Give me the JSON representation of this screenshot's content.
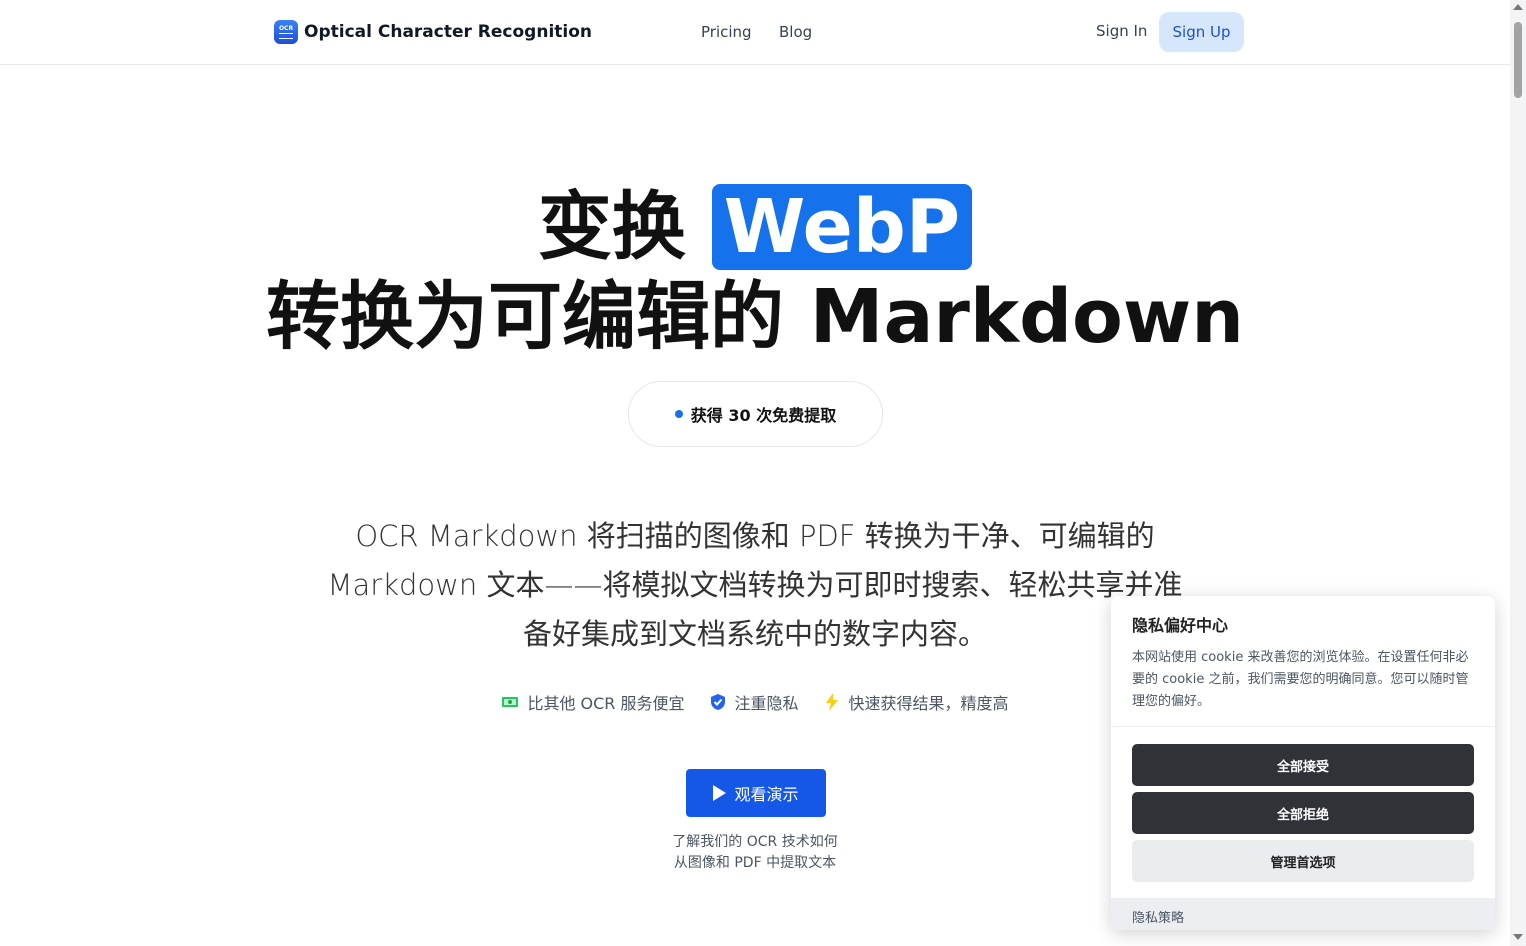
{
  "header": {
    "brand_name": "Optical Character Recognition",
    "logo_text": "OCR",
    "nav": [
      "Pricing",
      "Blog"
    ],
    "sign_in": "Sign In",
    "sign_up": "Sign Up"
  },
  "hero": {
    "line1_prefix": "变换",
    "line1_highlight": "WebP",
    "line2": "转换为可编辑的 Markdown",
    "pill": "获得 30 次免费提取",
    "description": "OCR Markdown 将扫描的图像和 PDF 转换为干净、可编辑的 Markdown 文本——将模拟文档转换为可即时搜索、轻松共享并准备好集成到文档系统中的数字内容。",
    "features": [
      "比其他 OCR 服务便宜",
      "注重隐私",
      "快速获得结果，精度高"
    ],
    "demo_button": "观看演示",
    "demo_caption_1": "了解我们的 OCR 技术如何",
    "demo_caption_2": "从图像和 PDF 中提取文本"
  },
  "cookie": {
    "title": "隐私偏好中心",
    "text": "本网站使用 cookie 来改善您的浏览体验。在设置任何非必要的 cookie 之前，我们需要您的明确同意。您可以随时管理您的偏好。",
    "accept_all": "全部接受",
    "reject_all": "全部拒绝",
    "manage": "管理首选项",
    "policy": "隐私策略"
  },
  "colors": {
    "accent": "#1672ec",
    "button_blue": "#1558e8",
    "signup_bg": "#d7e7fb",
    "dark_button": "#2f3237"
  }
}
